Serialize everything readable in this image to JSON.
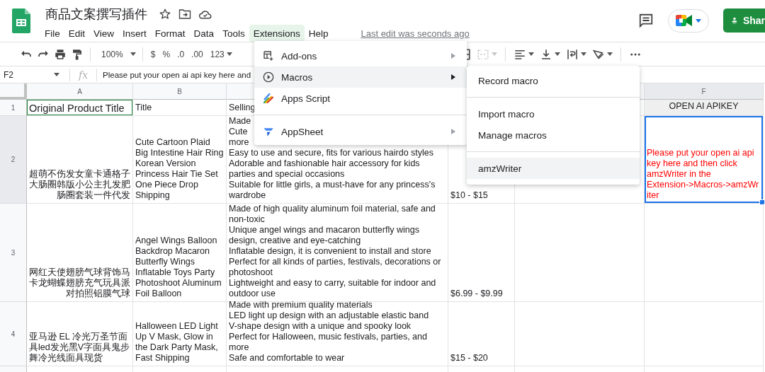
{
  "document": {
    "title": "商品文案撰写插件",
    "last_edit": "Last edit was seconds ago"
  },
  "menu_bar": [
    {
      "label": "File",
      "selected": false
    },
    {
      "label": "Edit",
      "selected": false
    },
    {
      "label": "View",
      "selected": false
    },
    {
      "label": "Insert",
      "selected": false
    },
    {
      "label": "Format",
      "selected": false
    },
    {
      "label": "Data",
      "selected": false
    },
    {
      "label": "Tools",
      "selected": false
    },
    {
      "label": "Extensions",
      "selected": true
    },
    {
      "label": "Help",
      "selected": false
    }
  ],
  "share_button": {
    "label": "Shar"
  },
  "toolbar": {
    "zoom": "100%",
    "currency": "$",
    "percent": "%",
    "decrease_decimals": ".0",
    "increase_decimals": ".00",
    "more_formats": "123",
    "merge_disabled": true
  },
  "formula_bar": {
    "cell_ref": "F2",
    "fx": "fx",
    "value": "Please put your open ai api key here and"
  },
  "columns": [
    {
      "letter": "A",
      "selected": false
    },
    {
      "letter": "B",
      "selected": false
    },
    {
      "letter": "F",
      "selected": true
    }
  ],
  "rows": [
    {
      "number": "1",
      "selected": false,
      "cells": [
        {
          "kind": "title",
          "lines": [
            "Original Product Title"
          ],
          "right_aligned": false,
          "selected": false
        },
        {
          "kind": "text",
          "lines": [
            "Title"
          ],
          "right_aligned": false,
          "selected": false
        },
        {
          "kind": "text",
          "lines": [
            "Selling"
          ],
          "right_aligned": false,
          "selected": false
        },
        {
          "kind": "covered"
        },
        {
          "kind": "text",
          "selected": false
        },
        {
          "kind": "header",
          "lines": [
            "OPEN AI APIKEY"
          ],
          "selected": false
        }
      ]
    },
    {
      "number": "2",
      "selected": true,
      "cells": [
        {
          "kind": "text",
          "lines": [
            "超萌不伤发女童卡通格子",
            "大肠圈韩版小公主扎发肥",
            "肠圈套装一件代发"
          ],
          "right_aligned": true,
          "selected": false
        },
        {
          "kind": "text",
          "lines": [
            "Cute Cartoon Plaid",
            "Big Intestine Hair Ring",
            "Korean Version",
            "Princess Hair Tie Set",
            "One Piece Drop",
            "Shipping"
          ],
          "right_aligned": false,
          "selected": false
        },
        {
          "kind": "text",
          "lines": [
            "Made",
            "Cute",
            "more",
            "Easy to use and secure, fits for various hairdo styles",
            "Adorable and fashionable hair accessory for kids",
            "parties and special occasions",
            "Suitable for little girls, a must-have for any princess's",
            "wardrobe"
          ],
          "right_aligned": false,
          "selected": false
        },
        {
          "kind": "text",
          "lines": [
            "$10 - $15"
          ],
          "right_aligned": false,
          "selected": false
        },
        {
          "kind": "text",
          "selected": false
        },
        {
          "kind": "note",
          "lines": [
            "Please put your open ai api",
            "key here and then click",
            "amzWriter in the",
            "Extension->Macros->amzWr",
            "iter"
          ],
          "right_aligned": false,
          "selected": true
        }
      ]
    },
    {
      "number": "3",
      "selected": false,
      "cells": [
        {
          "kind": "text",
          "lines": [
            "网红天使翅膀气球背饰马",
            "卡龙蝴蝶翅膀充气玩具派",
            "对拍照铝膜气球"
          ],
          "right_aligned": true,
          "selected": false
        },
        {
          "kind": "text",
          "lines": [
            "Angel Wings Balloon",
            "Backdrop Macaron",
            "Butterfly Wings",
            "Inflatable Toys Party",
            "Photoshoot Aluminum",
            "Foil Balloon"
          ],
          "right_aligned": false,
          "selected": false
        },
        {
          "kind": "text",
          "lines": [
            "Made of high quality aluminum foil material, safe and",
            "non-toxic",
            "Unique angel wings and macaron butterfly wings",
            "design, creative and eye-catching",
            "Inflatable design, it is convenient to install and store",
            "Perfect for all kinds of parties, festivals, decorations or",
            "photoshoot",
            "Lightweight and easy to carry, suitable for indoor and",
            "outdoor use"
          ],
          "right_aligned": false,
          "selected": false
        },
        {
          "kind": "text",
          "lines": [
            "$6.99 - $9.99"
          ],
          "right_aligned": false,
          "selected": false
        },
        {
          "kind": "text",
          "selected": false
        },
        {
          "kind": "text",
          "selected": false
        }
      ]
    },
    {
      "number": "4",
      "selected": false,
      "cells": [
        {
          "kind": "text",
          "lines": [
            "亚马逊 EL 冷光万圣节面",
            "具led发光黑V字面具鬼步",
            "舞冷光线面具现货"
          ],
          "right_aligned": false,
          "selected": false
        },
        {
          "kind": "text",
          "lines": [
            "Halloween LED Light",
            "Up V Mask, Glow in",
            "the Dark Party Mask,",
            "Fast Shipping"
          ],
          "right_aligned": false,
          "selected": false
        },
        {
          "kind": "text",
          "lines": [
            "Made with premium quality materials",
            "LED light up design with an adjustable elastic band",
            "V-shape design with a unique and spooky look",
            "Perfect for Halloween, music festivals, parties, and",
            "more",
            "Safe and comfortable to wear"
          ],
          "right_aligned": false,
          "selected": false
        },
        {
          "kind": "text",
          "lines": [
            "$15 - $20"
          ],
          "right_aligned": false,
          "selected": false
        },
        {
          "kind": "text",
          "selected": false
        },
        {
          "kind": "text",
          "selected": false
        }
      ]
    }
  ],
  "extensions_menu": [
    [
      {
        "label": "Add-ons",
        "selected": false,
        "submenu": true
      },
      {
        "label": "Macros",
        "selected": true,
        "submenu": true
      },
      {
        "label": "Apps Script",
        "selected": false,
        "submenu": false
      }
    ],
    [
      {
        "label": "AppSheet",
        "selected": false,
        "submenu": true
      }
    ]
  ],
  "macros_submenu": [
    [
      {
        "label": "Record macro",
        "selected": false
      }
    ],
    [
      {
        "label": "Import macro",
        "selected": false
      },
      {
        "label": "Manage macros",
        "selected": false
      }
    ],
    [
      {
        "label": "amzWriter",
        "selected": true
      }
    ]
  ]
}
